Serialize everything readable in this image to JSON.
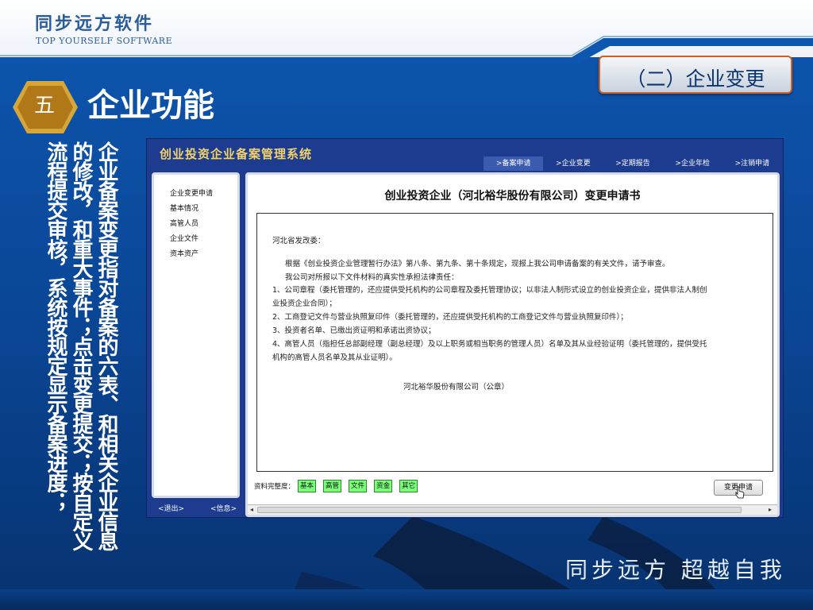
{
  "brand": {
    "cn": "同步远方软件",
    "en": "TOP YOURSELF SOFTWARE"
  },
  "section_badge": "（二）企业变更",
  "slide": {
    "number": "五",
    "title": "企业功能"
  },
  "vertical_text": "企业备案变更指对备案的六表、和相关企业信息的修改，和重大事件；点击变更提交；按自定义流程提交审核，系统按规定显示备案进度；",
  "app": {
    "title": "创业投资企业备案管理系统",
    "nav": [
      ">备案申请",
      ">企业变更",
      ">定期报告",
      ">企业年检",
      ">注销申请"
    ],
    "sidebar": [
      "企业变更申请",
      "基本情况",
      "高管人员",
      "企业文件",
      "资本资产"
    ],
    "footer": {
      "exit": "<退出>",
      "info": "<信息>"
    },
    "document": {
      "heading": "创业投资企业（河北裕华股份有限公司）变更申请书",
      "lines": [
        "河北省发改委：",
        "根据《创业投资企业管理暂行办法》第八条、第九条、第十条规定，现报上我公司申请备案的有关文件，请予审查。",
        "我公司对所报以下文件材料的真实性承担法律责任：",
        "1、公司章程（委托管理的，还应提供受托机构的公司章程及委托管理协议；以非法人制形式设立的创业投资企业，提供非法人制创",
        "业投资企业合同）；",
        "2、工商登记文件与营业执照复印件（委托管理的，还应提供受托机构的工商登记文件与营业执照复印件）；",
        "3、投资者名单、已缴出资证明和承诺出资协议；",
        "4、高管人员（指担任总部副经理（副总经理）及以上职务或相当职务的管理人员）名单及其从业经验证明（委托管理的，提供受托",
        "机构的高管人员名单及其从业证明）。",
        "河北裕华股份有限公司（公章）"
      ]
    },
    "completion_label": "资料完整度：",
    "completion_items": [
      "基本",
      "高管",
      "文件",
      "资金",
      "其它"
    ],
    "apply_button": "变更申请"
  },
  "slogan": "同步远方  超越自我",
  "colors": {
    "accent_orange": "#c9622a",
    "app_title": "#f2d26b",
    "chip_green": "#7bff7b"
  }
}
